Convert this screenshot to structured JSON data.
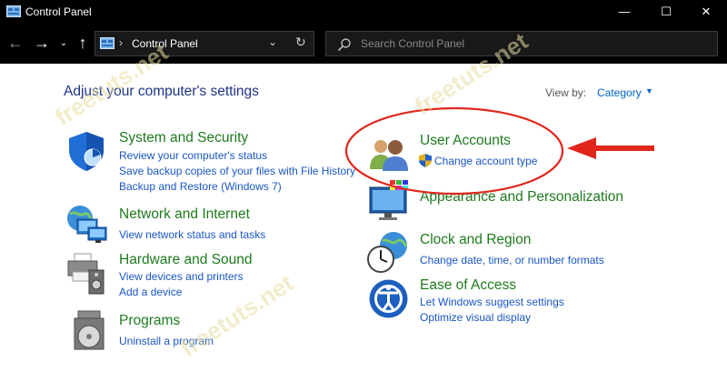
{
  "window": {
    "title": "Control Panel",
    "controls": {
      "minimize": "—",
      "maximize": "☐",
      "close": "✕"
    }
  },
  "address_bar": {
    "back": "←",
    "forward": "→",
    "recent": "⌄",
    "up": "↑",
    "separator": "›",
    "breadcrumb": "Control Panel",
    "dropdown": "⌄",
    "refresh": "↻",
    "search_placeholder": "Search Control Panel"
  },
  "main": {
    "heading": "Adjust your computer's settings",
    "view_by_label": "View by:",
    "view_by_value": "Category",
    "view_by_arrow": "▼"
  },
  "categories": [
    {
      "title": "System and Security",
      "icon": "shield-icon",
      "links": [
        "Review your computer's status",
        "Save backup copies of your files with File History",
        "Backup and Restore (Windows 7)"
      ]
    },
    {
      "title": "Network and Internet",
      "icon": "network-globe-icon",
      "links": [
        "View network status and tasks"
      ]
    },
    {
      "title": "Hardware and Sound",
      "icon": "printer-speaker-icon",
      "links": [
        "View devices and printers",
        "Add a device"
      ]
    },
    {
      "title": "Programs",
      "icon": "programs-disc-icon",
      "links": [
        "Uninstall a program"
      ]
    },
    {
      "title": "User Accounts",
      "icon": "users-icon",
      "links": [
        "Change account type"
      ],
      "link_icon": "uac-shield-icon"
    },
    {
      "title": "Appearance and Personalization",
      "icon": "monitor-palette-icon",
      "links": []
    },
    {
      "title": "Clock and Region",
      "icon": "clock-globe-icon",
      "links": [
        "Change date, time, or number formats"
      ]
    },
    {
      "title": "Ease of Access",
      "icon": "ease-of-access-icon",
      "links": [
        "Let Windows suggest settings",
        "Optimize visual display"
      ]
    }
  ],
  "watermark": "freetuts.net",
  "colors": {
    "titlebar": "#000000",
    "heading": "#1e3287",
    "category_title": "#1e7a1e",
    "link": "#1a56c6",
    "annotation": "#e0261b"
  }
}
